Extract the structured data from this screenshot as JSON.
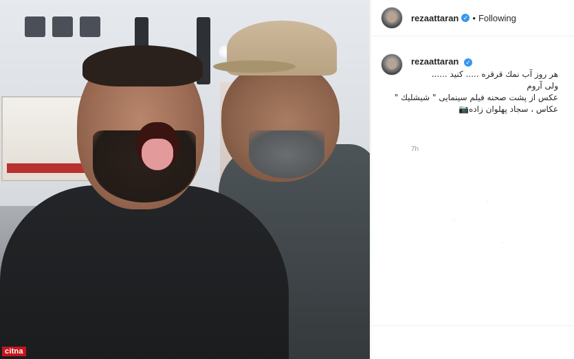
{
  "post": {
    "photo_alt": "Behind-the-scenes photo of two men, one with tongue out",
    "watermark": "citna"
  },
  "header": {
    "username": "rezaattaran",
    "verified": true,
    "separator": "•",
    "follow_state": "Following"
  },
  "caption": {
    "username": "rezaattaran",
    "lines": [
      "هر روز آب نمك قرقره ..... كنيد ......",
      "ولى آروم",
      "عكس از پشت صحنه فيلم سينمايى \" شيشليك \"",
      "عكاس ، سجاد پهلوان زاده📷"
    ],
    "time": "7h"
  },
  "icons": {
    "verified": "verified-badge-icon",
    "camera": "camera-icon"
  },
  "colors": {
    "verified": "#3897f0",
    "text": "#262626",
    "muted": "#999999",
    "watermark_bg": "#c4161c"
  }
}
